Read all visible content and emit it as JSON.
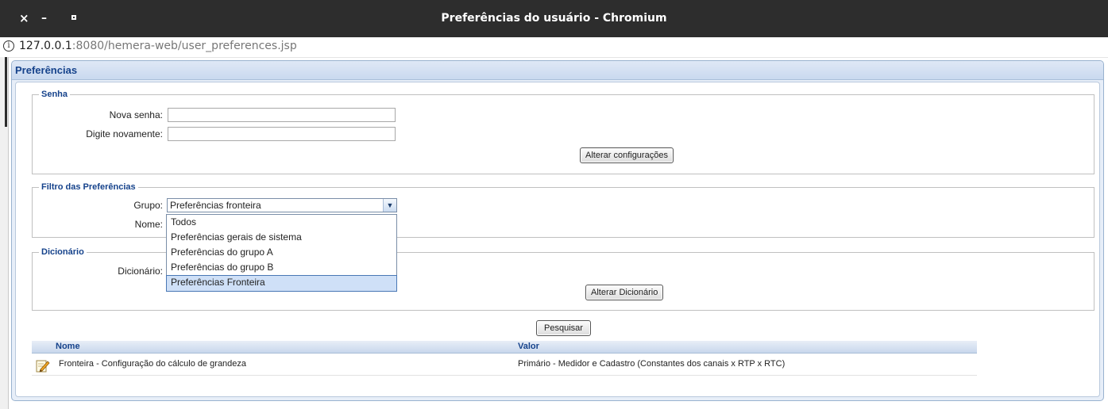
{
  "window": {
    "title": "Preferências do usuário - Chromium",
    "close_glyph": "×",
    "minimize_glyph": "–"
  },
  "address": {
    "host": "127.0.0.1",
    "rest": ":8080/hemera-web/user_preferences.jsp"
  },
  "panel": {
    "title": "Preferências"
  },
  "senha": {
    "legend": "Senha",
    "nova_label": "Nova senha:",
    "nova_value": "",
    "repetir_label": "Digite novamente:",
    "repetir_value": "",
    "button": "Alterar configurações"
  },
  "filtro": {
    "legend": "Filtro das Preferências",
    "grupo_label": "Grupo:",
    "grupo_value": "Preferências fronteira",
    "nome_label": "Nome:",
    "options": [
      {
        "label": "Todos",
        "selected": false
      },
      {
        "label": "Preferências gerais de sistema",
        "selected": false
      },
      {
        "label": "Preferências do grupo A",
        "selected": false
      },
      {
        "label": "Preferências do grupo B",
        "selected": false
      },
      {
        "label": "Preferências Fronteira",
        "selected": true
      }
    ]
  },
  "dicionario": {
    "legend": "Dicionário",
    "label": "Dicionário:",
    "button": "Alterar Dicionário"
  },
  "search": {
    "button": "Pesquisar"
  },
  "grid": {
    "columns": [
      "Nome",
      "Valor"
    ],
    "rows": [
      {
        "icon": "edit-icon",
        "nome": "Fronteira - Configuração do cálculo de grandeza",
        "valor": "Primário - Medidor e Cadastro (Constantes dos canais x RTP x RTC)"
      }
    ]
  },
  "colors": {
    "titlebar": "#2d2d2d",
    "panel_title": "#15428b",
    "selection": "#cfe0f7"
  }
}
